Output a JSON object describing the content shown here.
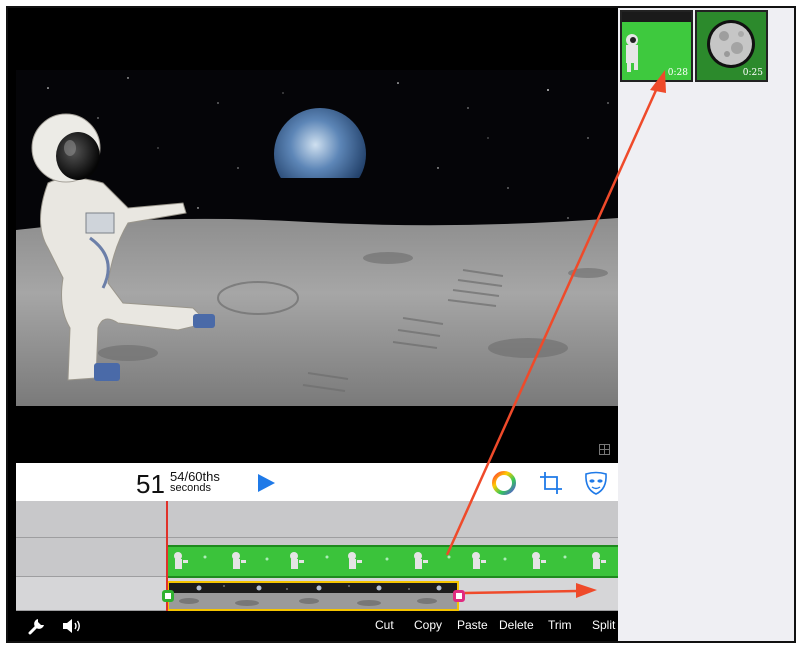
{
  "time": {
    "seconds": "51",
    "fraction": "54/60ths",
    "unit": "seconds"
  },
  "library": {
    "clips": [
      {
        "duration": "0:28",
        "thumb_icon": "astronaut-green-screen-thumb"
      },
      {
        "duration": "0:25",
        "thumb_icon": "moon-thumb"
      }
    ]
  },
  "toolbar": {
    "play_icon": "play-icon",
    "color_icon": "color-wheel-icon",
    "crop_icon": "crop-icon",
    "mask_icon": "mask-icon"
  },
  "bottombar": {
    "settings_icon": "wrench-icon",
    "audio_icon": "speaker-icon",
    "actions": [
      "Cut",
      "Copy",
      "Paste",
      "Delete",
      "Trim",
      "Split"
    ]
  },
  "colors": {
    "accent_blue": "#1f7ae8",
    "clip_green": "#3bc33b",
    "playhead_red": "#e0312a",
    "selection_yellow": "#f5c400",
    "annotation_red": "#ef4a2a"
  }
}
